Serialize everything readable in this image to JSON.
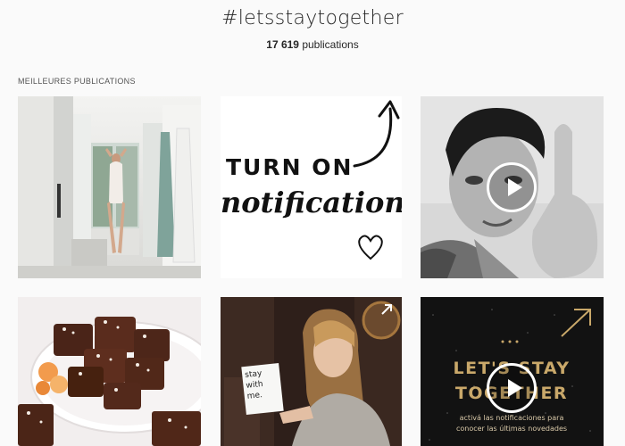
{
  "header": {
    "hashtag": "#letsstaytogether",
    "count": "17 619",
    "count_suffix": " publications"
  },
  "section": {
    "label": "MEILLEURES PUBLICATIONS"
  },
  "posts": [
    {
      "kind": "photo",
      "icon": "bathroom-photo"
    },
    {
      "kind": "graphic",
      "line1": "TURN ON",
      "line2": "notifications"
    },
    {
      "kind": "video",
      "icon": "play-icon"
    },
    {
      "kind": "photo",
      "icon": "brownies-photo"
    },
    {
      "kind": "photo",
      "card_text": "stay with me."
    },
    {
      "kind": "video",
      "title_line1": "LET'S STAY",
      "title_line2": "TOGETHER",
      "subtitle_line1": "activá las notificaciones para",
      "subtitle_line2": "conocer las últimas novedades"
    }
  ],
  "colors": {
    "background": "#fafafa",
    "text": "#262626",
    "gold": "#c9a86a"
  }
}
